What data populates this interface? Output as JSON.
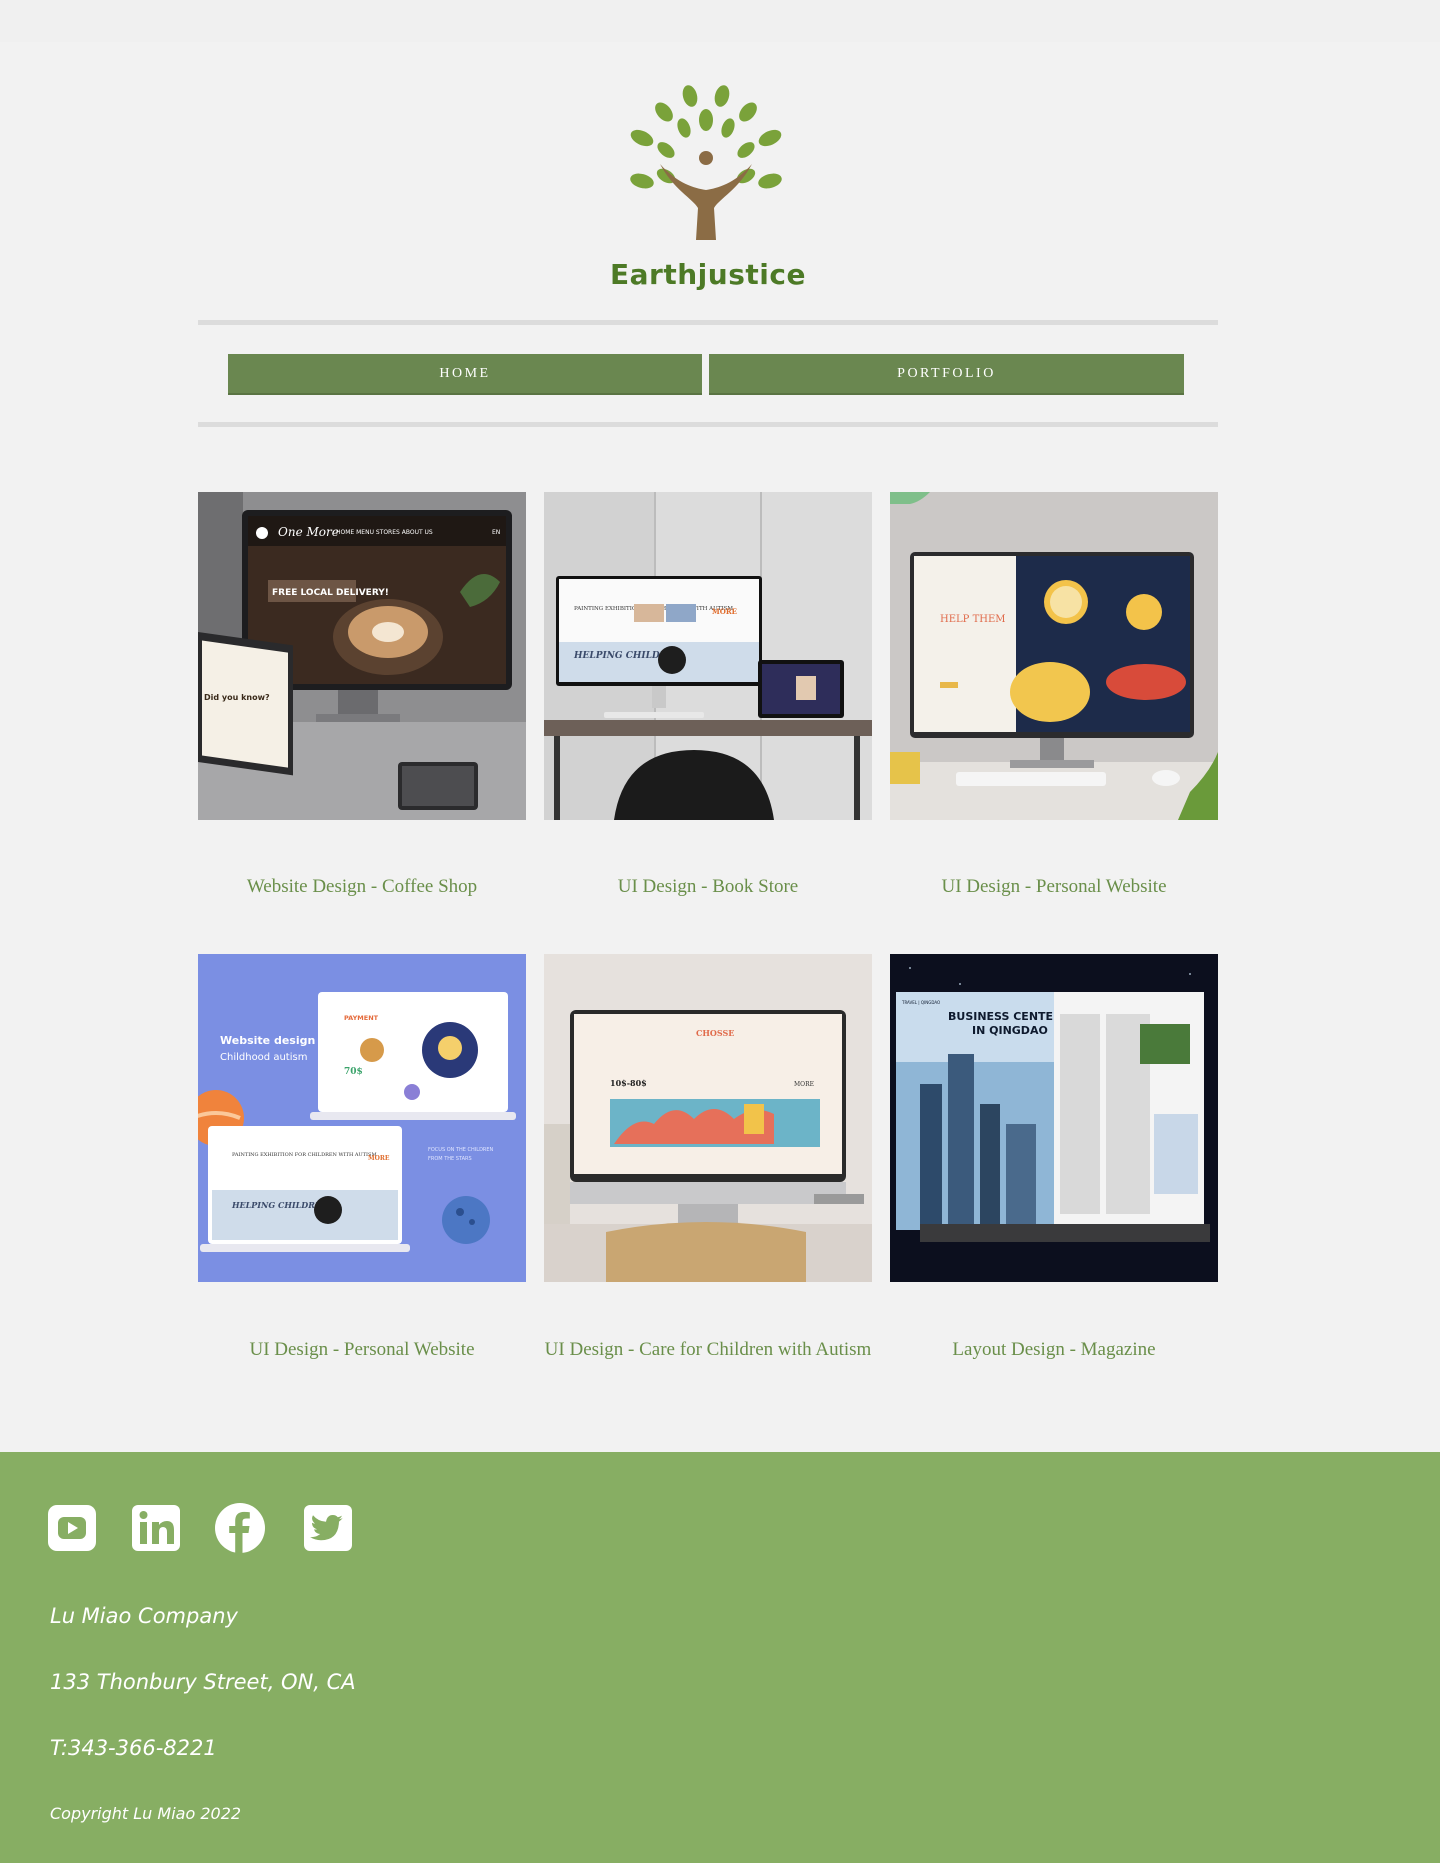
{
  "brand": {
    "name": "Earthjustice",
    "logo_icon": "tree-person-icon",
    "leaf_color": "#7aa23a",
    "trunk_color": "#8b6c45",
    "text_color": "#4d7a26"
  },
  "nav": {
    "home_label": "HOME",
    "portfolio_label": "PORTFOLIO",
    "color": "#6a8750"
  },
  "portfolio": [
    {
      "title": "Website Design - Coffee Shop",
      "image": "coffee-shop-mockup"
    },
    {
      "title": "UI Design - Book Store",
      "image": "book-store-mockup"
    },
    {
      "title": "UI Design - Personal Website",
      "image": "personal-website-mockup"
    },
    {
      "title": "UI Design - Personal Website",
      "image": "childhood-autism-mockup"
    },
    {
      "title": "UI Design - Care for Children with Autism",
      "image": "care-children-mockup"
    },
    {
      "title": "Layout Design - Magazine",
      "image": "magazine-mockup"
    }
  ],
  "mockup_text": {
    "coffee_brand": "One More",
    "coffee_menu": "HOME  MENU  STORES  ABOUT US",
    "coffee_lang": "EN",
    "coffee_banner": "FREE LOCAL DELIVERY!",
    "coffee_did": "Did you know?",
    "book_heading": "PAINTING EXHIBITION FOR CHILDREN WITH AUTISM",
    "book_more": "MORE",
    "book_help": "HELPING CHILDREN",
    "personal_help": "HELP THEM",
    "autism_title_1": "Website design .",
    "autism_title_2": "Childhood autism",
    "autism_payment": "PAYMENT",
    "autism_price": "70$",
    "autism_focus_1": "FOCUS ON THE CHILDREN",
    "autism_focus_2": "FROM THE STARS",
    "care_heading": "CHOSSE",
    "care_price": "10$-80$",
    "care_more": "MORE",
    "mag_title_1": "BUSINESS CENTER",
    "mag_title_2": "IN QINGDAO",
    "mag_kicker": "TRAVEL | QINGDAO"
  },
  "footer": {
    "background": "#87ae63",
    "social": [
      {
        "name": "youtube-icon"
      },
      {
        "name": "linkedin-icon"
      },
      {
        "name": "facebook-icon"
      },
      {
        "name": "twitter-icon"
      }
    ],
    "company": "Lu Miao Company",
    "address": "133 Thonbury Street, ON, CA",
    "phone": "T:343-366-8221",
    "copyright": "Copyright Lu Miao 2022"
  }
}
